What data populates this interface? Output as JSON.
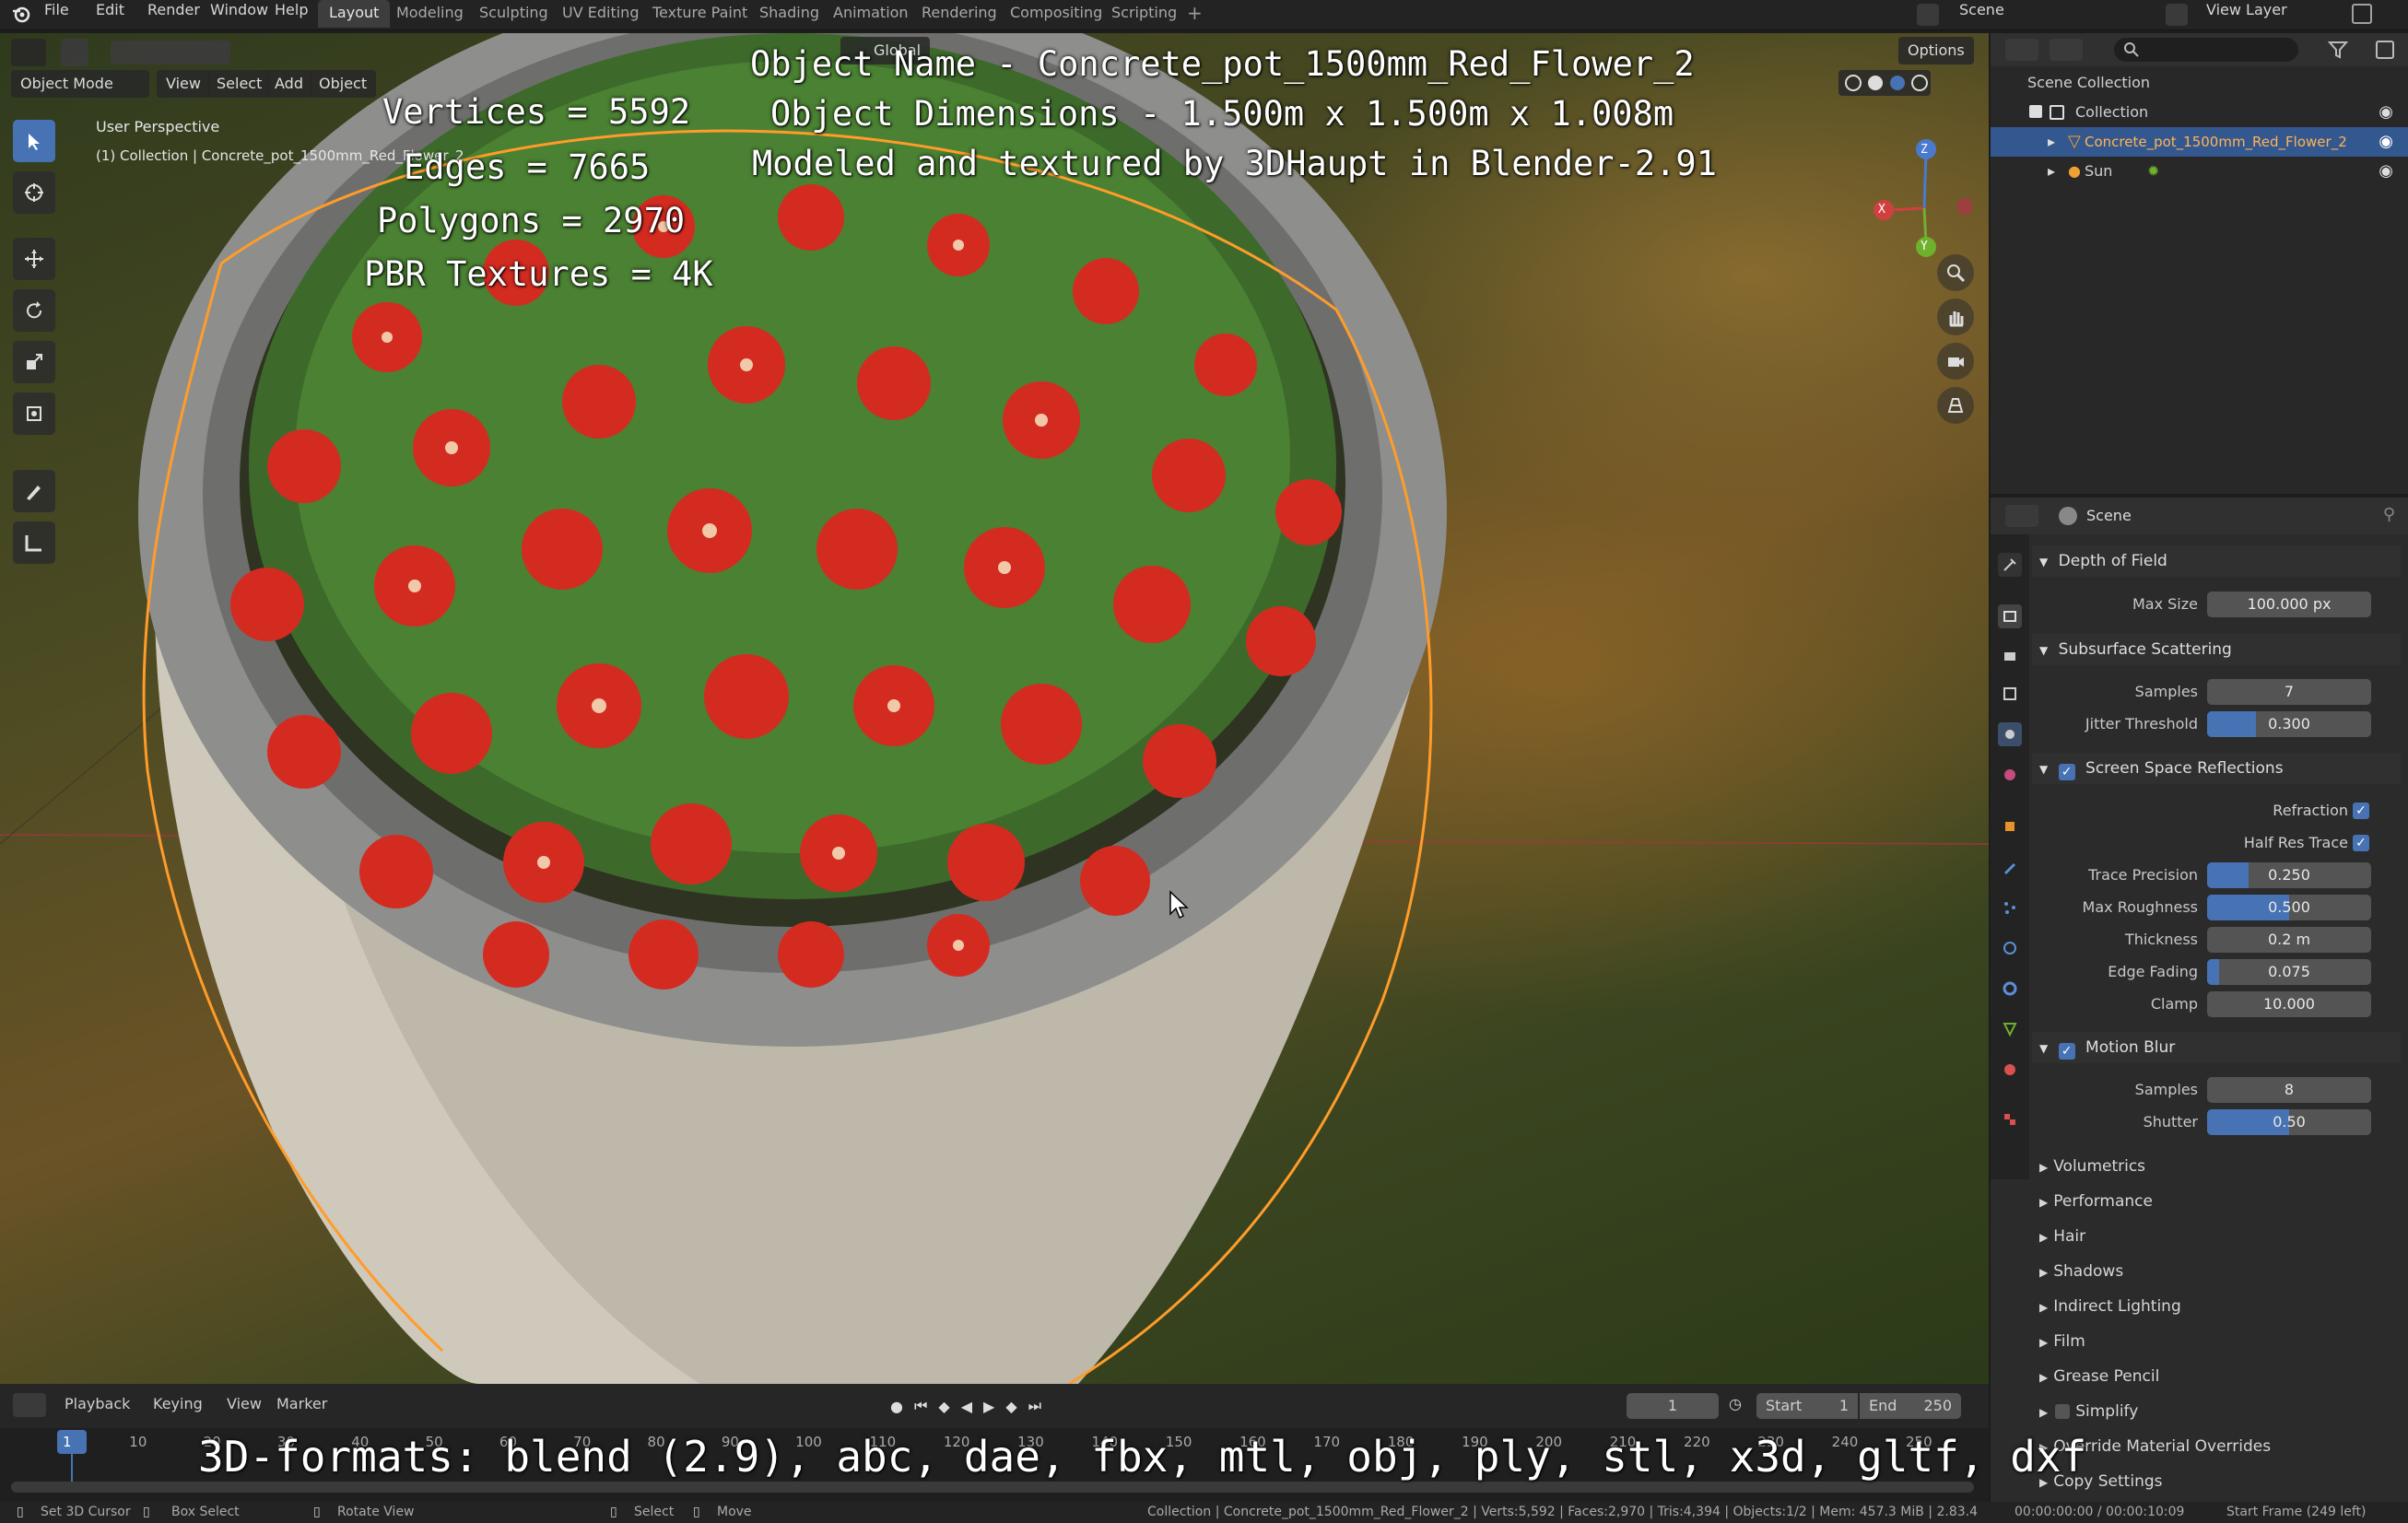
{
  "topbar": {
    "menus": [
      "File",
      "Edit",
      "Render",
      "Window",
      "Help"
    ],
    "workspaces": [
      "Layout",
      "Modeling",
      "Sculpting",
      "UV Editing",
      "Texture Paint",
      "Shading",
      "Animation",
      "Rendering",
      "Compositing",
      "Scripting"
    ],
    "active_workspace": "Layout",
    "scene_label": "Scene",
    "view_layer_label": "View Layer"
  },
  "viewport": {
    "mode": "Object Mode",
    "header_menus": [
      "View",
      "Select",
      "Add",
      "Object"
    ],
    "orientation": "Global",
    "options_label": "Options",
    "perspective_label": "User Perspective",
    "collection_path": "(1) Collection | Concrete_pot_1500mm_Red_Flower_2",
    "overlay": {
      "object_name": "Object Name - Concrete_pot_1500mm_Red_Flower_2",
      "dimensions": "Object Dimensions -  1.500m x 1.500m x 1.008m",
      "credit": "Modeled and textured by 3DHaupt in Blender-2.91",
      "vertices": "Vertices = 5592",
      "edges": "Edges = 7665",
      "polygons": "Polygons = 2970",
      "textures": "PBR Textures = 4K",
      "formats": "3D-formats: blend (2.9), abc, dae, fbx, mtl, obj, ply, stl, x3d, gltf, dxf"
    },
    "gizmo": {
      "x": "X",
      "y": "Y",
      "z": "Z"
    }
  },
  "outliner": {
    "root": "Scene Collection",
    "collection": "Collection",
    "items": [
      "Concrete_pot_1500mm_Red_Flower_2",
      "Sun"
    ]
  },
  "properties": {
    "context": "Scene",
    "depth_of_field": {
      "title": "Depth of Field",
      "max_size_label": "Max Size",
      "max_size": "100.000 px"
    },
    "sss": {
      "title": "Subsurface Scattering",
      "samples_label": "Samples",
      "samples": "7",
      "jitter_label": "Jitter Threshold",
      "jitter": "0.300",
      "jitter_fill": 0.3
    },
    "ssr": {
      "title": "Screen Space Reflections",
      "refraction_label": "Refraction",
      "half_res_label": "Half Res Trace",
      "rows": [
        {
          "label": "Trace Precision",
          "value": "0.250",
          "fill": 0.25
        },
        {
          "label": "Max Roughness",
          "value": "0.500",
          "fill": 0.5
        },
        {
          "label": "Thickness",
          "value": "0.2 m",
          "fill": 0
        },
        {
          "label": "Edge Fading",
          "value": "0.075",
          "fill": 0.075
        },
        {
          "label": "Clamp",
          "value": "10.000",
          "fill": 0
        }
      ]
    },
    "motion_blur": {
      "title": "Motion Blur",
      "samples_label": "Samples",
      "samples": "8",
      "shutter_label": "Shutter",
      "shutter": "0.50",
      "shutter_fill": 0.5
    },
    "collapsed": [
      "Volumetrics",
      "Performance",
      "Hair",
      "Shadows",
      "Indirect Lighting",
      "Film",
      "Grease Pencil",
      "Simplify",
      "Override Material Overrides",
      "Copy Settings"
    ]
  },
  "timeline": {
    "menus": [
      "Playback",
      "Keying",
      "View",
      "Marker"
    ],
    "current_frame": "1",
    "start_label": "Start",
    "start": "1",
    "end_label": "End",
    "end": "250",
    "ticks": [
      "1",
      "10",
      "20",
      "30",
      "40",
      "50",
      "60",
      "70",
      "80",
      "90",
      "100",
      "110",
      "120",
      "130",
      "140",
      "150",
      "160",
      "170",
      "180",
      "190",
      "200",
      "210",
      "220",
      "230",
      "240",
      "250"
    ]
  },
  "statusbar": {
    "items": [
      "Set 3D Cursor",
      "Box Select",
      "Rotate View",
      "Select",
      "Move"
    ],
    "info": "Collection | Concrete_pot_1500mm_Red_Flower_2 | Verts:5,592 | Faces:2,970 | Tris:4,394 | Objects:1/2 | Mem: 457.3 MiB | 2.83.4",
    "time": "00:00:00:00 / 00:00:10:09",
    "start_frame": "Start Frame (249 left)"
  }
}
